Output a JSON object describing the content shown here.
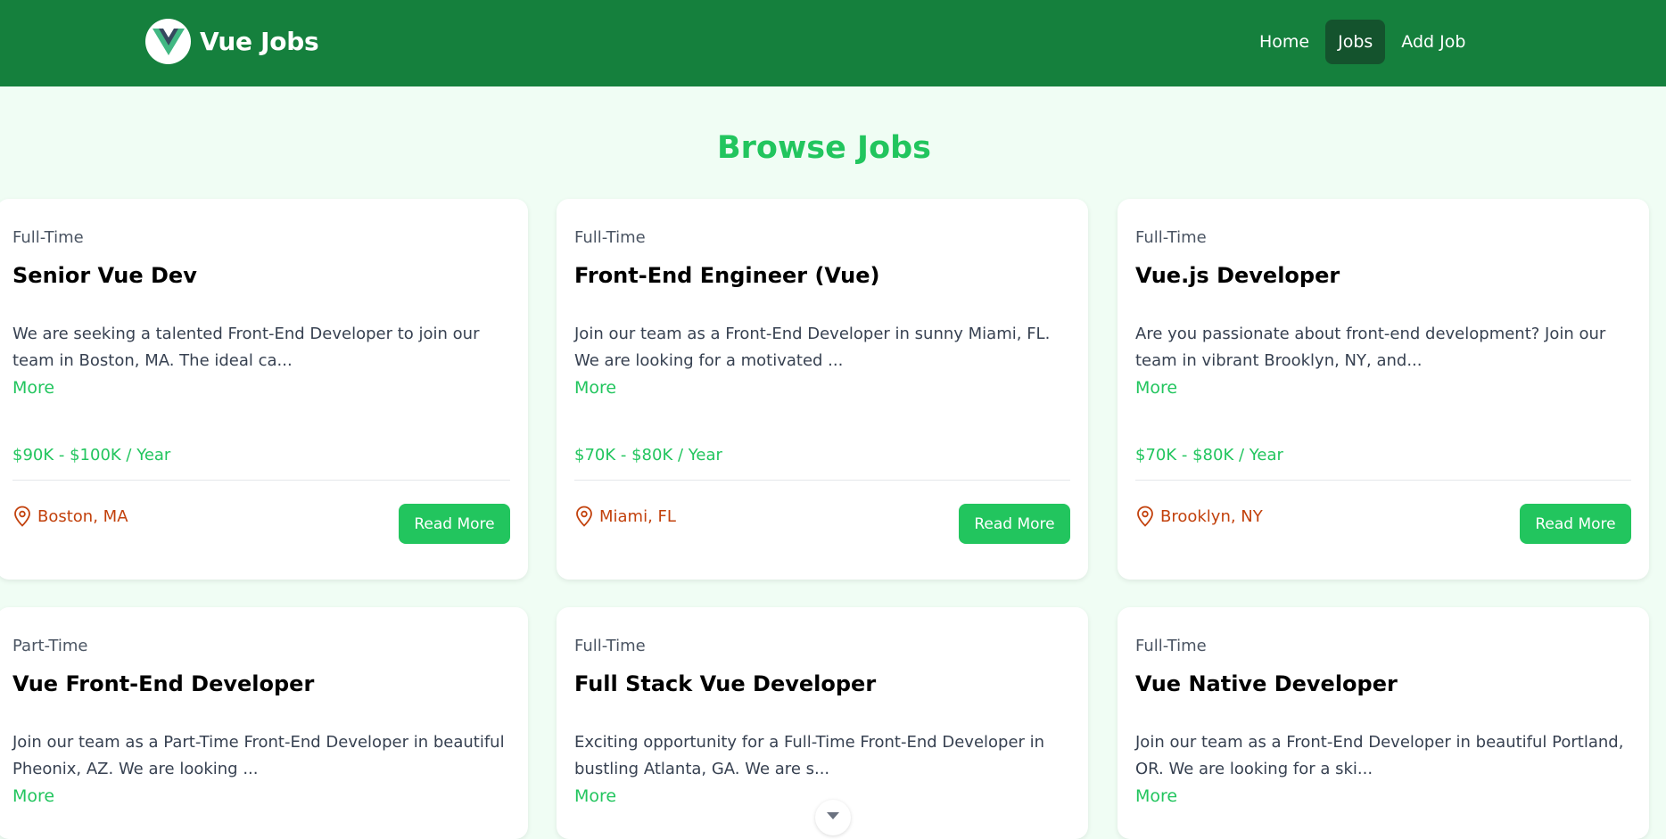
{
  "navbar": {
    "brand_name": "Vue Jobs",
    "links": [
      {
        "label": "Home",
        "active": false
      },
      {
        "label": "Jobs",
        "active": true
      },
      {
        "label": "Add Job",
        "active": false
      }
    ]
  },
  "page": {
    "title": "Browse Jobs"
  },
  "jobs": [
    {
      "type": "Full-Time",
      "title": "Senior Vue Dev",
      "description": "We are seeking a talented Front-End Developer to join our team in Boston, MA. The ideal ca...",
      "more_label": "More",
      "salary": "$90K - $100K / Year",
      "location": "Boston, MA",
      "button_label": "Read More"
    },
    {
      "type": "Full-Time",
      "title": "Front-End Engineer (Vue)",
      "description": "Join our team as a Front-End Developer in sunny Miami, FL. We are looking for a motivated ...",
      "more_label": "More",
      "salary": "$70K - $80K / Year",
      "location": "Miami, FL",
      "button_label": "Read More"
    },
    {
      "type": "Full-Time",
      "title": "Vue.js Developer",
      "description": "Are you passionate about front-end development? Join our team in vibrant Brooklyn, NY, and...",
      "more_label": "More",
      "salary": "$70K - $80K / Year",
      "location": "Brooklyn, NY",
      "button_label": "Read More"
    },
    {
      "type": "Part-Time",
      "title": "Vue Front-End Developer",
      "description": "Join our team as a Part-Time Front-End Developer in beautiful Pheonix, AZ. We are looking ...",
      "more_label": "More"
    },
    {
      "type": "Full-Time",
      "title": "Full Stack Vue Developer",
      "description": "Exciting opportunity for a Full-Time Front-End Developer in bustling Atlanta, GA. We are s...",
      "more_label": "More"
    },
    {
      "type": "Full-Time",
      "title": "Vue Native Developer",
      "description": "Join our team as a Front-End Developer in beautiful Portland, OR. We are looking for a ski...",
      "more_label": "More"
    }
  ],
  "colors": {
    "navbar_bg": "#15803d",
    "active_link_bg": "#14532d",
    "page_bg": "#f0fdf4",
    "accent_green": "#22c55e",
    "location_orange": "#c2410c"
  },
  "icons": {
    "brand": "vue-logo-icon",
    "location": "map-pin-icon",
    "scroll": "chevron-down-icon"
  }
}
